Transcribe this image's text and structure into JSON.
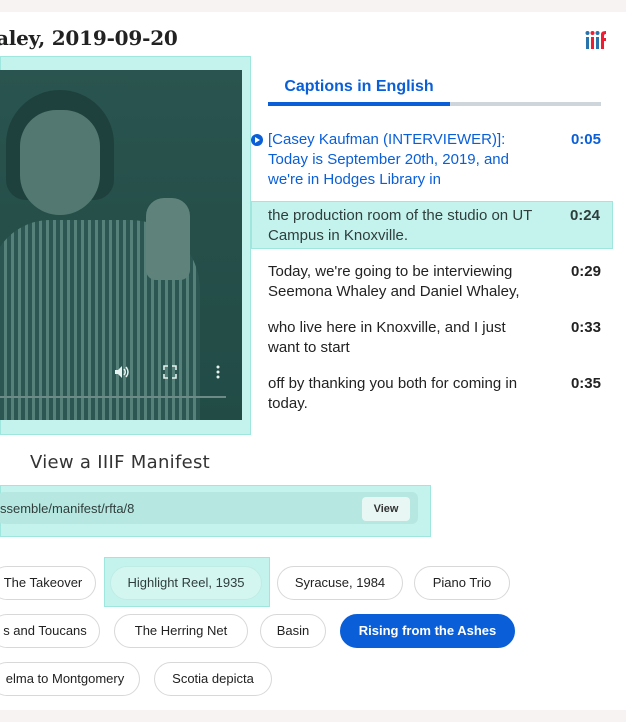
{
  "header": {
    "title": "aley, 2019-09-20",
    "logo": "iiif"
  },
  "colors": {
    "accent": "#0a5fd8",
    "highlight": "#c4f3ee"
  },
  "video": {
    "icons": [
      "volume-icon",
      "fullscreen-icon",
      "more-options-icon"
    ]
  },
  "captions": {
    "tab_label": "Captions in English",
    "cues": [
      {
        "text": "[Casey Kaufman (INTERVIEWER)]: Today is September 20th, 2019, and we're in Hodges Library in",
        "time": "0:05"
      },
      {
        "text": "the production room of the studio on UT Campus in Knoxville.",
        "time": "0:24"
      },
      {
        "text": "Today, we're going to be interviewing Seemona Whaley and Daniel Whaley,",
        "time": "0:29"
      },
      {
        "text": "who live here in Knoxville, and I just want to start",
        "time": "0:33"
      },
      {
        "text": "off by thanking you both for coming in today.",
        "time": "0:35"
      }
    ]
  },
  "manifest": {
    "title": "View a IIIF Manifest",
    "url": "ssemble/manifest/rfta/8",
    "button_label": "View"
  },
  "chips": [
    "The Takeover",
    "Highlight Reel, 1935",
    "Syracuse, 1984",
    "Piano Trio",
    "s and Toucans",
    "The Herring Net",
    "Basin",
    "Rising from the Ashes",
    "elma to Montgomery",
    "Scotia depicta"
  ]
}
